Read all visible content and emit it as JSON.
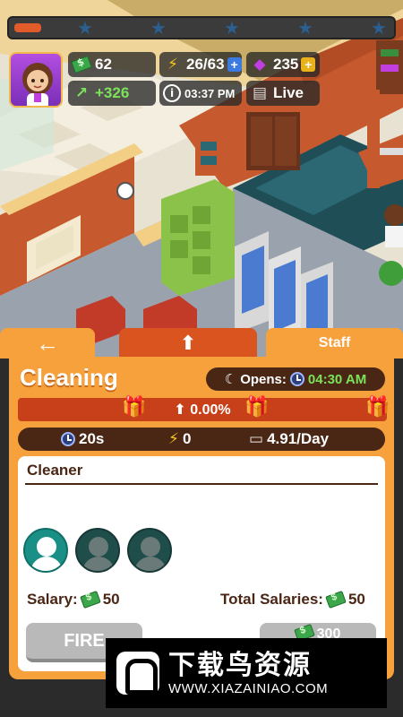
{
  "colors": {
    "panel": "#f6a13c",
    "accent_red": "#c7401a",
    "dark_brown": "#4a2614",
    "green_text": "#7be35a",
    "progress": "#e25b2a",
    "gem": "#c13ee0"
  },
  "hud": {
    "level_progress": 0.07,
    "stars": 5,
    "avatar_icon": "manager-avatar-icon",
    "cash": "62",
    "income": "+326",
    "energy": "26/63",
    "gems": "235",
    "time": "03:37 PM",
    "live_label": "Live",
    "info_icon": "i"
  },
  "tabs": {
    "back": "←",
    "upgrade": "⬆",
    "staff": "Staff"
  },
  "department": {
    "title": "Cleaning",
    "opens_label": "Opens:",
    "opens_time": "04:30 AM",
    "boost": "0.00%",
    "stat_time": "20s",
    "stat_energy": "0",
    "stat_rate": "4.91/Day"
  },
  "staff": {
    "role": "Cleaner",
    "slots": [
      "filled",
      "empty",
      "empty"
    ],
    "salary_label": "Salary:",
    "salary_value": "50",
    "total_label": "Total Salaries:",
    "total_value": "50",
    "fire_label": "FIRE",
    "hire_cost": "300"
  },
  "watermark": {
    "name": "下载鸟资源",
    "url": "WWW.XIAZAINIAO.COM"
  }
}
